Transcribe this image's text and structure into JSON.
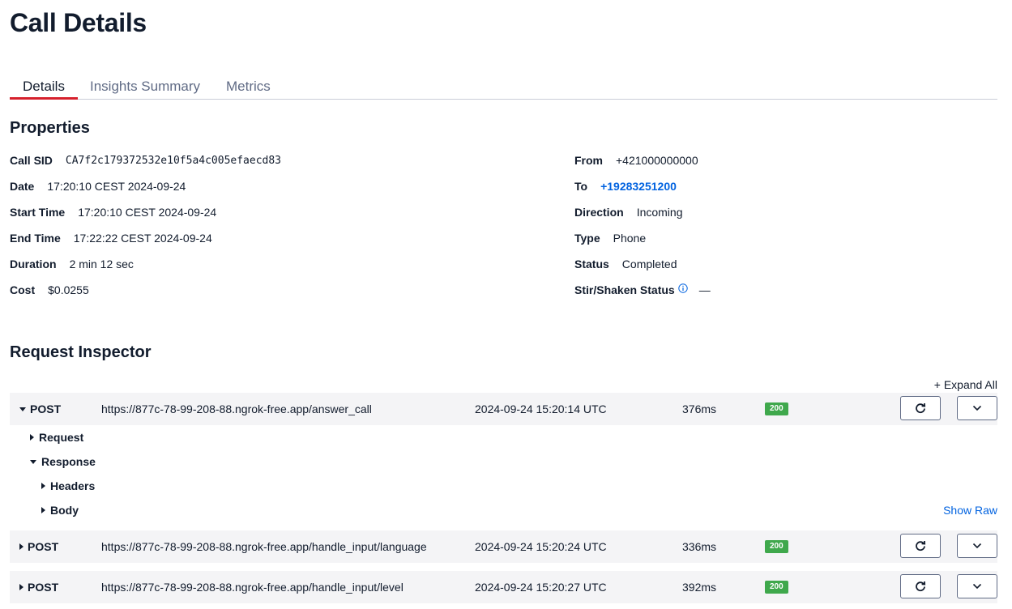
{
  "page": {
    "title": "Call Details"
  },
  "tabs": [
    {
      "label": "Details",
      "active": true
    },
    {
      "label": "Insights Summary",
      "active": false
    },
    {
      "label": "Metrics",
      "active": false
    }
  ],
  "properties": {
    "title": "Properties",
    "left": [
      {
        "key": "Call SID",
        "value": "CA7f2c179372532e10f5a4c005efaecd83"
      },
      {
        "key": "Date",
        "value": "17:20:10 CEST 2024-09-24"
      },
      {
        "key": "Start Time",
        "value": "17:20:10 CEST 2024-09-24"
      },
      {
        "key": "End Time",
        "value": "17:22:22 CEST 2024-09-24"
      },
      {
        "key": "Duration",
        "value": "2 min 12 sec"
      },
      {
        "key": "Cost",
        "value": "$0.0255"
      }
    ],
    "right": [
      {
        "key": "From",
        "value": "+421000000000"
      },
      {
        "key": "To",
        "value": "+19283251200"
      },
      {
        "key": "Direction",
        "value": "Incoming"
      },
      {
        "key": "Type",
        "value": "Phone"
      },
      {
        "key": "Status",
        "value": "Completed"
      },
      {
        "key": "Stir/Shaken Status",
        "value": "—"
      }
    ]
  },
  "inspector": {
    "title": "Request Inspector",
    "expand_all": "+ Expand All",
    "show_raw": "Show Raw",
    "tree": {
      "request": "Request",
      "response": "Response",
      "headers": "Headers",
      "body": "Body"
    },
    "requests": [
      {
        "method": "POST",
        "url": "https://877c-78-99-208-88.ngrok-free.app/answer_call",
        "time": "2024-09-24 15:20:14 UTC",
        "duration": "376ms",
        "status": "200",
        "expanded": true
      },
      {
        "method": "POST",
        "url": "https://877c-78-99-208-88.ngrok-free.app/handle_input/language",
        "time": "2024-09-24 15:20:24 UTC",
        "duration": "336ms",
        "status": "200",
        "expanded": false
      },
      {
        "method": "POST",
        "url": "https://877c-78-99-208-88.ngrok-free.app/handle_input/level",
        "time": "2024-09-24 15:20:27 UTC",
        "duration": "392ms",
        "status": "200",
        "expanded": false
      }
    ]
  },
  "colors": {
    "accent": "#d6202c",
    "link": "#0263e0",
    "success": "#3fa84c",
    "row_bg": "#f4f4f6"
  },
  "icons": {
    "retry": "refresh-icon",
    "toggle": "chevron-down-icon",
    "info": "info-icon"
  }
}
